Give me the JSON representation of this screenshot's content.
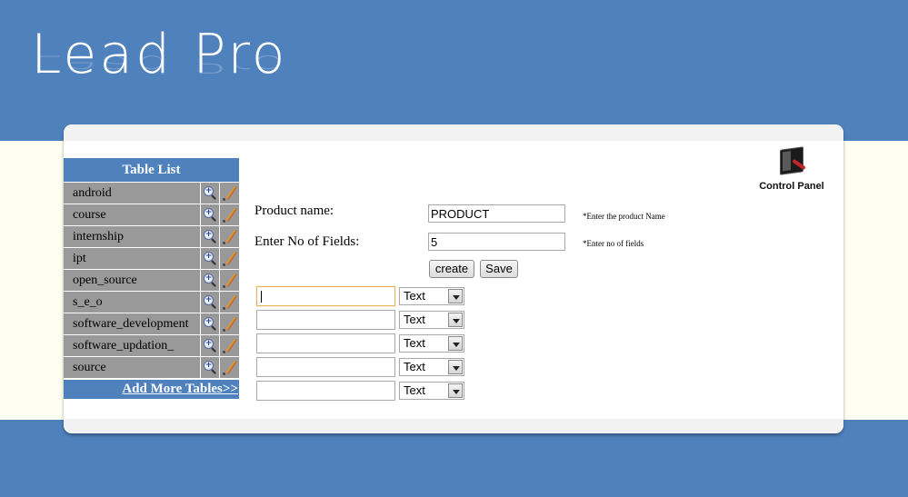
{
  "logo": {
    "text": "Lead Pro"
  },
  "control_panel": {
    "label": "Control Panel",
    "icon": "control-panel-icon"
  },
  "table_list": {
    "title": "Table List",
    "items": [
      {
        "name": "android"
      },
      {
        "name": "course"
      },
      {
        "name": "internship"
      },
      {
        "name": "ipt"
      },
      {
        "name": "open_source"
      },
      {
        "name": "s_e_o"
      },
      {
        "name": "software_development"
      },
      {
        "name": "software_updation_"
      },
      {
        "name": "source"
      }
    ],
    "add_more_label": "Add More Tables>>"
  },
  "form": {
    "product_name_label": "Product name:",
    "product_name_value": "PRODUCT",
    "product_name_hint": "*Enter the product Name",
    "fields_label": "Enter No of Fields:",
    "fields_value": "5",
    "fields_hint": "*Enter no of fields",
    "create_label": "create",
    "save_label": "Save",
    "field_rows": [
      {
        "value": "",
        "type": "Text"
      },
      {
        "value": "",
        "type": "Text"
      },
      {
        "value": "",
        "type": "Text"
      },
      {
        "value": "",
        "type": "Text"
      },
      {
        "value": "",
        "type": "Text"
      }
    ]
  },
  "colors": {
    "header_blue": "#4f81bd",
    "row_gray": "#999999",
    "band_cream": "#fefef0"
  }
}
